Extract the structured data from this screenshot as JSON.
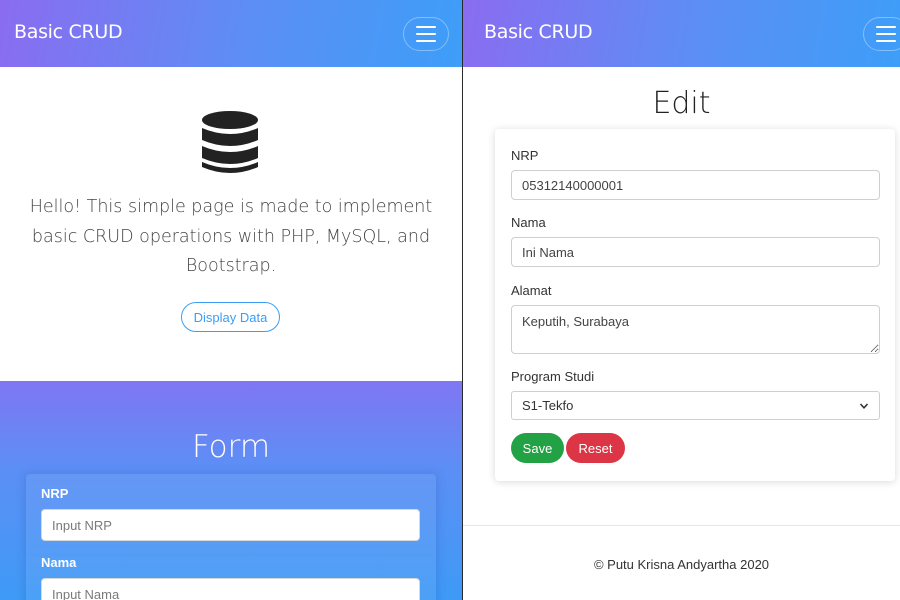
{
  "left": {
    "brand": "Basic CRUD",
    "hero": {
      "icon": "database-icon",
      "text": "Hello! This simple page is made to implement basic CRUD operations with PHP, MySQL, and Bootstrap.",
      "button_label": "Display Data"
    },
    "form": {
      "title": "Form",
      "nrp_label": "NRP",
      "nrp_placeholder": "Input NRP",
      "nama_label": "Nama",
      "nama_placeholder": "Input Nama"
    }
  },
  "right": {
    "brand": "Basic CRUD",
    "title": "Edit",
    "nrp_label": "NRP",
    "nrp_value": "05312140000001",
    "nama_label": "Nama",
    "nama_value": "Ini Nama",
    "alamat_label": "Alamat",
    "alamat_value": "Keputih, Surabaya",
    "prodi_label": "Program Studi",
    "prodi_value": "S1-Tekfo",
    "save_label": "Save",
    "reset_label": "Reset",
    "footer": "© Putu Krisna Andyartha 2020"
  },
  "colors": {
    "navbar_gradient_start": "#8a6cf0",
    "navbar_gradient_end": "#3d9ef8",
    "accent_blue": "#3b9ef5",
    "save_green": "#22a245",
    "reset_red": "#dc3545"
  }
}
